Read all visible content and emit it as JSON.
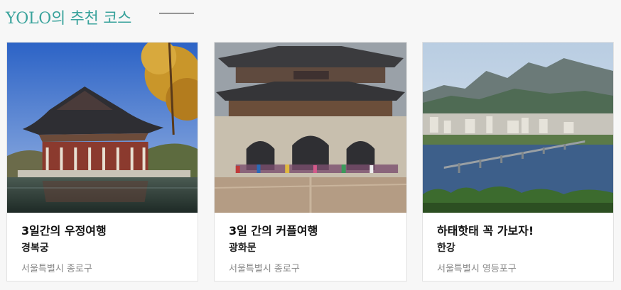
{
  "section": {
    "title": "YOLO의 추천 코스"
  },
  "courses": [
    {
      "title": "3일간의 우정여행",
      "place": "경복궁",
      "location": "서울특별시 종로구",
      "image_icon": "palace-pavilion-photo"
    },
    {
      "title": "3일 간의 커플여행",
      "place": "광화문",
      "location": "서울특별시 종로구",
      "image_icon": "gate-photo"
    },
    {
      "title": "하태핫태 꼭 가보자!",
      "place": "한강",
      "location": "서울특별시 영등포구",
      "image_icon": "river-bridge-photo"
    }
  ],
  "colors": {
    "accent": "#3aa39c",
    "title_text": "#111111",
    "location_text": "#888888"
  }
}
